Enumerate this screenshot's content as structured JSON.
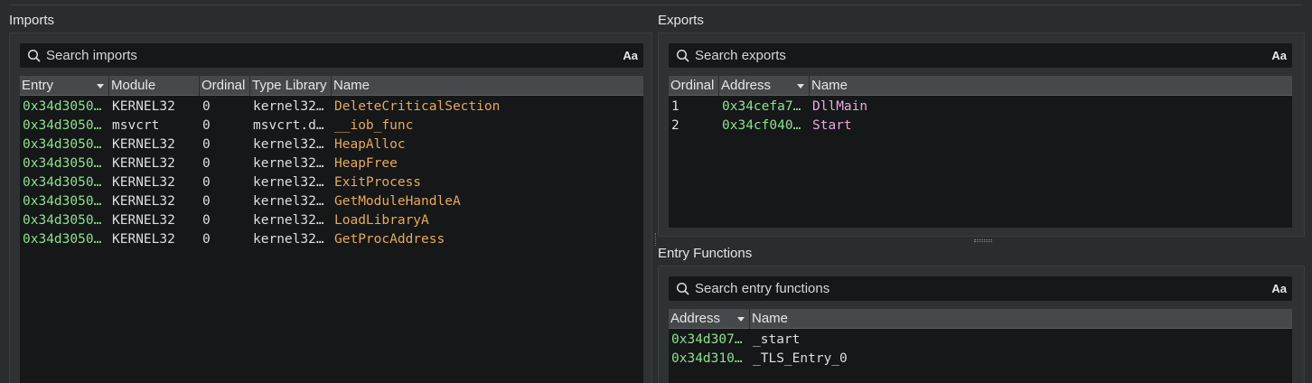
{
  "imports": {
    "title": "Imports",
    "search_placeholder": "Search imports",
    "case_toggle": "Aa",
    "columns": [
      "Entry",
      "Module",
      "Ordinal",
      "Type Library",
      "Name"
    ],
    "rows": [
      {
        "entry": "0x34d3050…",
        "module": "KERNEL32",
        "ordinal": "0",
        "typelib": "kernel32…",
        "name": "DeleteCriticalSection"
      },
      {
        "entry": "0x34d3050…",
        "module": "msvcrt",
        "ordinal": "0",
        "typelib": "msvcrt.d…",
        "name": "__iob_func"
      },
      {
        "entry": "0x34d3050…",
        "module": "KERNEL32",
        "ordinal": "0",
        "typelib": "kernel32…",
        "name": "HeapAlloc"
      },
      {
        "entry": "0x34d3050…",
        "module": "KERNEL32",
        "ordinal": "0",
        "typelib": "kernel32…",
        "name": "HeapFree"
      },
      {
        "entry": "0x34d3050…",
        "module": "KERNEL32",
        "ordinal": "0",
        "typelib": "kernel32…",
        "name": "ExitProcess"
      },
      {
        "entry": "0x34d3050…",
        "module": "KERNEL32",
        "ordinal": "0",
        "typelib": "kernel32…",
        "name": "GetModuleHandleA"
      },
      {
        "entry": "0x34d3050…",
        "module": "KERNEL32",
        "ordinal": "0",
        "typelib": "kernel32…",
        "name": "LoadLibraryA"
      },
      {
        "entry": "0x34d3050…",
        "module": "KERNEL32",
        "ordinal": "0",
        "typelib": "kernel32…",
        "name": "GetProcAddress"
      }
    ]
  },
  "exports": {
    "title": "Exports",
    "search_placeholder": "Search exports",
    "case_toggle": "Aa",
    "columns": [
      "Ordinal",
      "Address",
      "Name"
    ],
    "rows": [
      {
        "ordinal": "1",
        "address": "0x34cefa7…",
        "name": "DllMain"
      },
      {
        "ordinal": "2",
        "address": "0x34cf040…",
        "name": "Start"
      }
    ]
  },
  "entry_functions": {
    "title": "Entry Functions",
    "search_placeholder": "Search entry functions",
    "case_toggle": "Aa",
    "columns": [
      "Address",
      "Name"
    ],
    "rows": [
      {
        "address": "0x34d307…",
        "name": "_start"
      },
      {
        "address": "0x34d310…",
        "name": "_TLS_Entry_0"
      }
    ]
  },
  "colors": {
    "address": "#8ee08e",
    "import_name": "#e8a85a",
    "export_name": "#e8a8e0"
  }
}
